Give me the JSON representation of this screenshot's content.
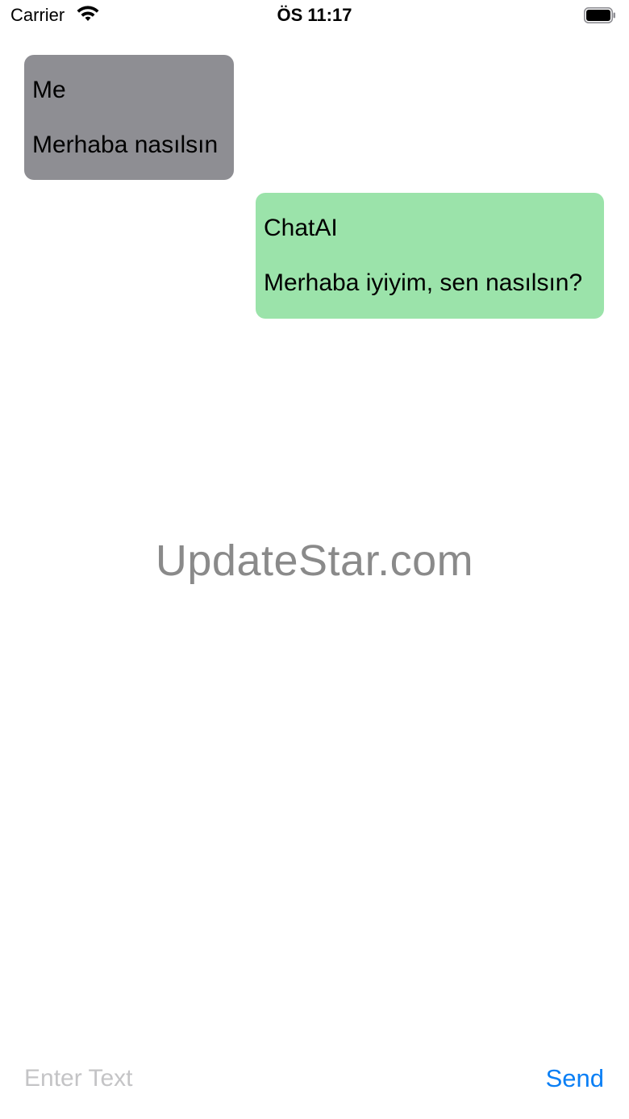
{
  "status_bar": {
    "carrier": "Carrier",
    "time": "ÖS 11:17"
  },
  "messages": [
    {
      "sender": "Me",
      "text": "Merhaba nasılsın",
      "color": "#8e8e93"
    },
    {
      "sender": "ChatAI",
      "text": "Merhaba iyiyim, sen nasılsın?",
      "color": "#9be3aa"
    }
  ],
  "watermark": "UpdateStar.com",
  "input": {
    "placeholder": "Enter Text",
    "value": ""
  },
  "send": {
    "label": "Send",
    "color": "#0a7ff5"
  },
  "icons": {
    "wifi": "wifi-icon",
    "battery": "battery-icon"
  }
}
